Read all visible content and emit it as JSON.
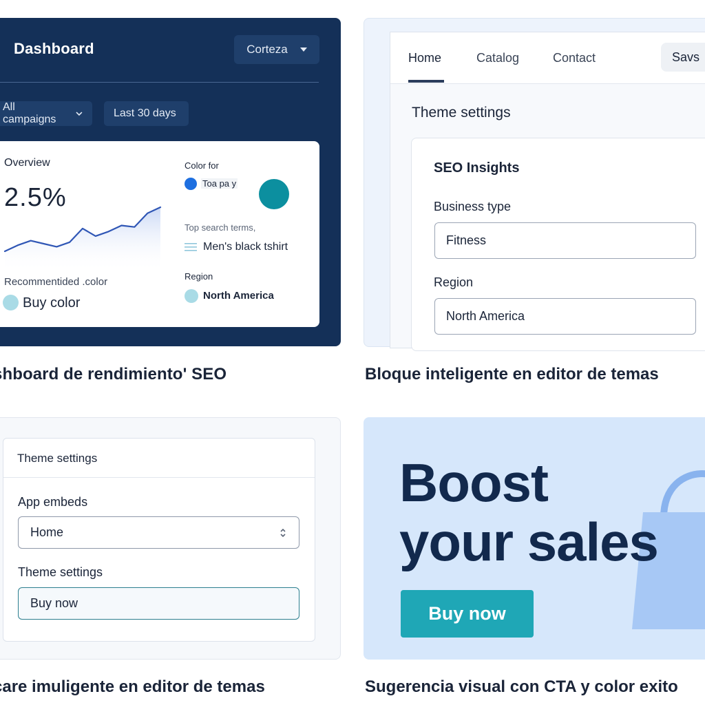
{
  "colors": {
    "dashboard_bg": "#143058",
    "accent_teal": "#1fa7b6",
    "promo_bg": "#d6e7fb",
    "headline_navy": "#12294d",
    "chart_line": "#2f56b5"
  },
  "dashboard": {
    "title": "Dashboard",
    "account": "Corteza",
    "account_icon": "chevron-down-icon",
    "filters": {
      "campaigns": "All campaigns",
      "range": "Last 30 days"
    },
    "overview": {
      "label": "Overview",
      "value": "2.5%",
      "trend": [
        5,
        9,
        12,
        10,
        8,
        11,
        20,
        15,
        18,
        22,
        21,
        30,
        34
      ]
    },
    "recommended": {
      "label": "Recommentided .color",
      "value": "Buy color"
    },
    "color_for": {
      "label": "Color for",
      "value": "Toa pa y"
    },
    "search_terms": {
      "label": "Top search terms,",
      "value": "Men's black tshirt"
    },
    "region": {
      "label": "Region",
      "value": "North America"
    },
    "caption": "shboard de rendimiento' SEO"
  },
  "theme_editor": {
    "nav": {
      "home": "Home",
      "catalog": "Catalog",
      "contact": "Contact",
      "save": "Savs"
    },
    "heading": "Theme settings",
    "card_title": "SEO Insights",
    "business_type": {
      "label": "Business type",
      "value": "Fitness"
    },
    "region": {
      "label": "Region",
      "value": "North America"
    },
    "caption": "Bloque inteligente en editor de temas"
  },
  "app_embeds": {
    "header": "Theme settings",
    "select": {
      "label": "App embeds",
      "value": "Home"
    },
    "input": {
      "label": "Theme settings",
      "value": "Buy now"
    },
    "caption": "care imuligente en editor de temas"
  },
  "promo": {
    "line1": "Boost",
    "line2": "your sales",
    "cta": "Buy now",
    "icon": "shopping-bag-icon",
    "caption": "Sugerencia visual con CTA y color exito"
  }
}
